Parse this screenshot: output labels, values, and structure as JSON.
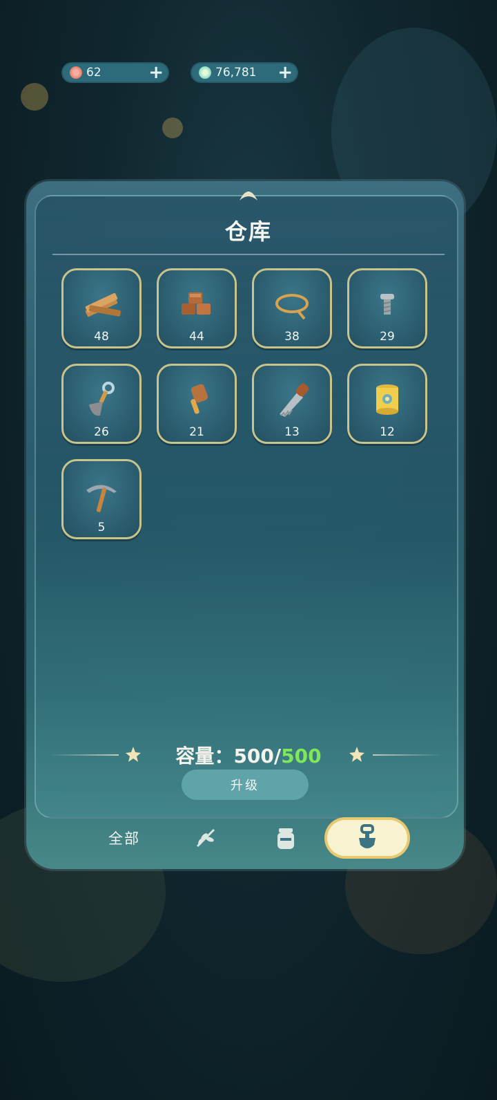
{
  "currency": [
    {
      "icon": "flower-coin-icon",
      "value": "62",
      "plus": "+"
    },
    {
      "icon": "star-gem-icon",
      "value": "76,781",
      "plus": "+"
    }
  ],
  "panel": {
    "title": "仓库",
    "items": [
      {
        "icon": "wood-planks-icon",
        "count": "48"
      },
      {
        "icon": "bricks-icon",
        "count": "44"
      },
      {
        "icon": "rope-icon",
        "count": "38"
      },
      {
        "icon": "screw-icon",
        "count": "29"
      },
      {
        "icon": "shovel-icon",
        "count": "26"
      },
      {
        "icon": "mallet-icon",
        "count": "21"
      },
      {
        "icon": "saw-icon",
        "count": "13"
      },
      {
        "icon": "paint-bucket-icon",
        "count": "12"
      },
      {
        "icon": "pickaxe-icon",
        "count": "5"
      }
    ],
    "capacity": {
      "label": "容量：",
      "current": "500",
      "separator": "/",
      "max": "500"
    },
    "upgrade_label": "升级"
  },
  "tabs": [
    {
      "label": "全部",
      "name": "tab-all"
    },
    {
      "icon": "plant-icon",
      "name": "tab-plants"
    },
    {
      "icon": "jar-icon",
      "name": "tab-jars"
    },
    {
      "icon": "shovel-tool-icon",
      "name": "tab-tools",
      "active": true
    }
  ],
  "colors": {
    "capacity_max": "#7ee85a",
    "slot_border": "#c9c48c",
    "active_tab": "#f7f2cf"
  }
}
